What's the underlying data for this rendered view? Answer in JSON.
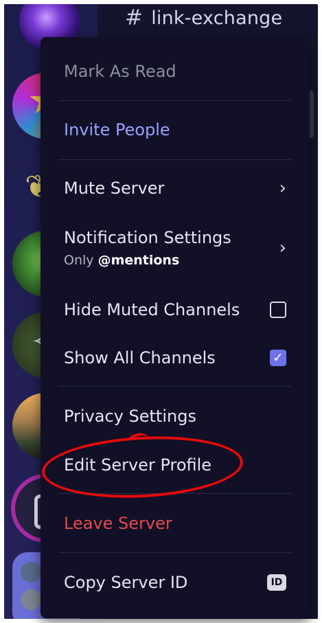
{
  "channel": {
    "hash": "#",
    "name": "link-exchange"
  },
  "menu": {
    "mark_as_read": "Mark As Read",
    "invite_people": "Invite People",
    "mute_server": "Mute Server",
    "notification_settings": {
      "label": "Notification Settings",
      "sub_prefix": "Only ",
      "sub_value": "@mentions"
    },
    "hide_muted_channels": {
      "label": "Hide Muted Channels",
      "checked": false
    },
    "show_all_channels": {
      "label": "Show All Channels",
      "checked": true
    },
    "privacy_settings": "Privacy Settings",
    "edit_server_profile": "Edit Server Profile",
    "leave_server": "Leave Server",
    "copy_server_id": "Copy Server ID",
    "id_badge": "ID",
    "chevron": "›",
    "check_mark": "✓"
  },
  "colors": {
    "menu_bg": "#111026",
    "accent": "#9aa1ff",
    "danger": "#e5484d",
    "checkbox_checked": "#6c72ea",
    "annotation": "#e50b0b"
  }
}
